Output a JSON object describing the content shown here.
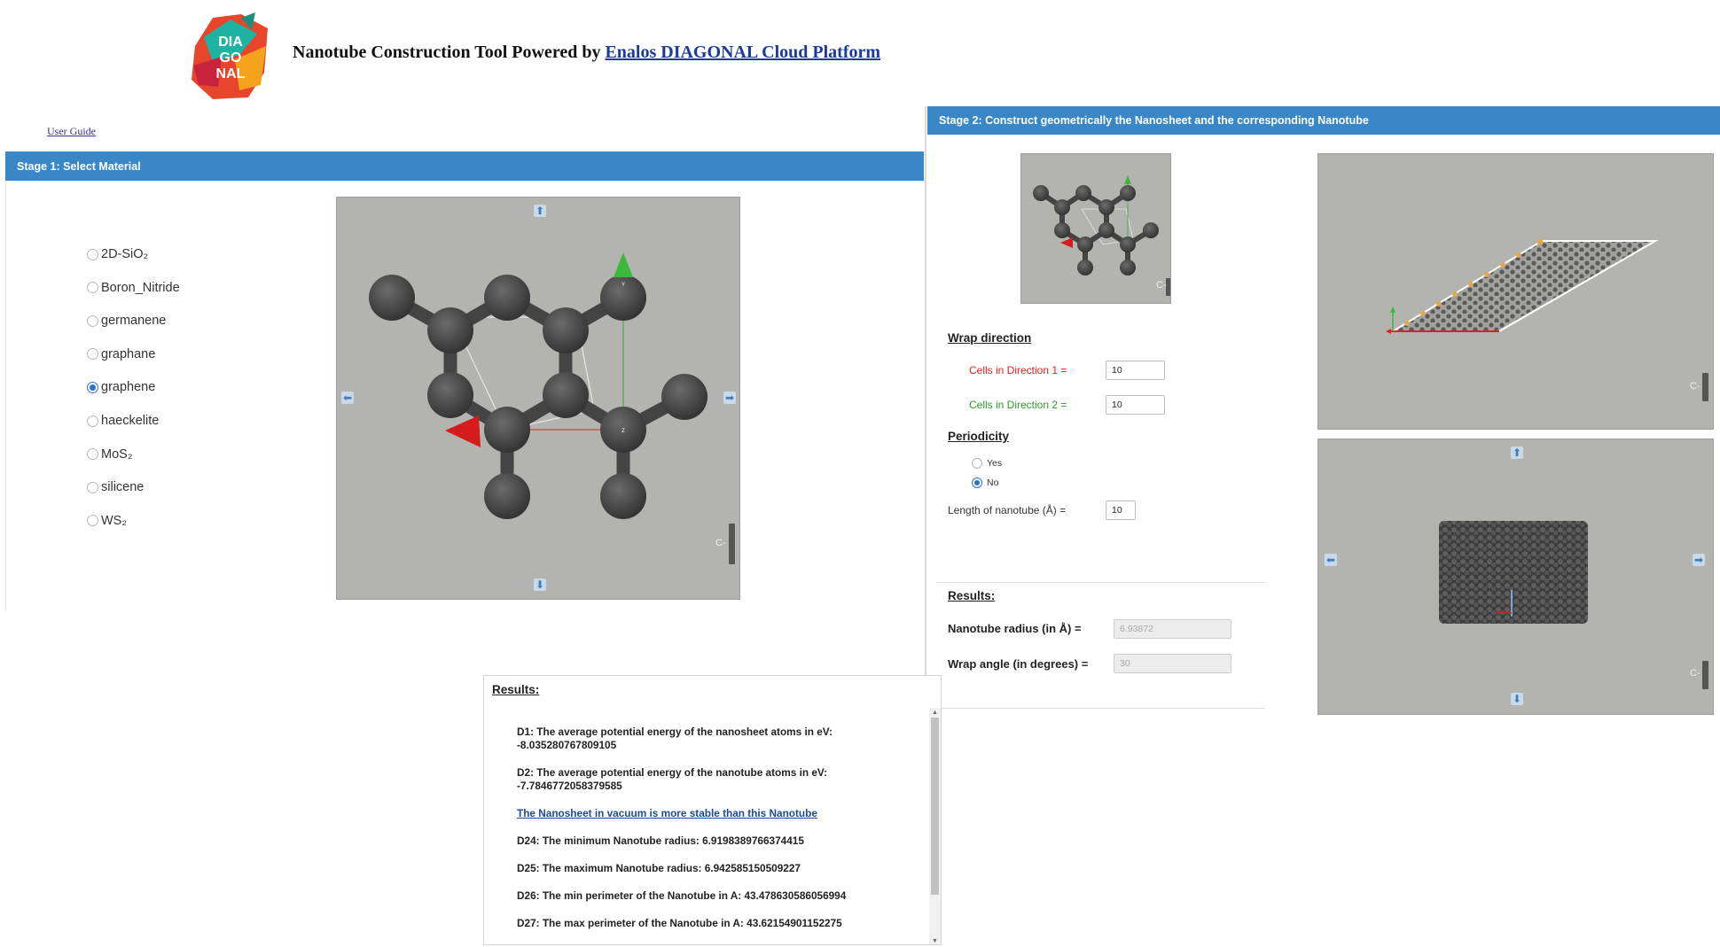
{
  "header": {
    "logo_text": [
      "DIA",
      "GO",
      "NAL"
    ],
    "title_prefix": "Nanotube Construction Tool Powered by ",
    "title_link": "Enalos DIAGONAL Cloud Platform",
    "user_guide": "User Guide"
  },
  "stage1": {
    "title": "Stage 1: Select Material",
    "materials": [
      {
        "label": "2D-SiO₂",
        "checked": false
      },
      {
        "label": "Boron_Nitride",
        "checked": false
      },
      {
        "label": "germanene",
        "checked": false
      },
      {
        "label": "graphane",
        "checked": false
      },
      {
        "label": "graphene",
        "checked": true
      },
      {
        "label": "haeckelite",
        "checked": false
      },
      {
        "label": "MoS₂",
        "checked": false
      },
      {
        "label": "silicene",
        "checked": false
      },
      {
        "label": "WS₂",
        "checked": false
      }
    ],
    "viewer_corner_label": "C-"
  },
  "stage2": {
    "title": "Stage 2: Construct geometrically the Nanosheet and the corresponding Nanotube",
    "wrap_direction_title": "Wrap direction",
    "cells_dir1_label": "Cells in Direction 1 =",
    "cells_dir1_value": "10",
    "cells_dir2_label": "Cells in Direction 2 =",
    "cells_dir2_value": "10",
    "periodicity_title": "Periodicity",
    "periodicity_yes": "Yes",
    "periodicity_no": "No",
    "periodicity_selected": "No",
    "length_label": "Length of nanotube (Å) =",
    "length_value": "10",
    "results_title": "Results:",
    "radius_label": "Nanotube radius (in Å) =",
    "radius_value": "6.93872",
    "angle_label": "Wrap angle (in degrees) =",
    "angle_value": "30",
    "viewer_corner_label": "C-"
  },
  "results": {
    "title": "Results:",
    "d1_label": "D1: The average potential energy of the nanosheet atoms in eV:",
    "d1_value": "-8.035280767809105",
    "d2_label": "D2: The average potential energy of the nanotube atoms in eV:",
    "d2_value": "-7.7846772058379585",
    "stability_link": "The Nanosheet in vacuum is more stable than this Nanotube",
    "d24": "D24: The minimum Nanotube radius: 6.9198389766374415",
    "d25": "D25: The maximum Nanotube radius: 6.942585150509227",
    "d26": "D26: The min perimeter of the Nanotube in A: 43.478630586056994",
    "d27": "D27: The max perimeter of the Nanotube in A: 43.62154901152275"
  },
  "colors": {
    "stage_bar": "#3a87c8",
    "viewer_bg": "#b3b3b0",
    "atom": "#4a4a4a",
    "dir1_label": "#e0201b",
    "dir2_label": "#2b9a2b",
    "link": "#1a3a9c"
  },
  "icons": [
    "diagonal-logo",
    "arrow-up-icon",
    "arrow-down-icon",
    "arrow-left-icon",
    "arrow-right-icon",
    "axis-x-arrow-icon",
    "axis-y-arrow-icon"
  ]
}
